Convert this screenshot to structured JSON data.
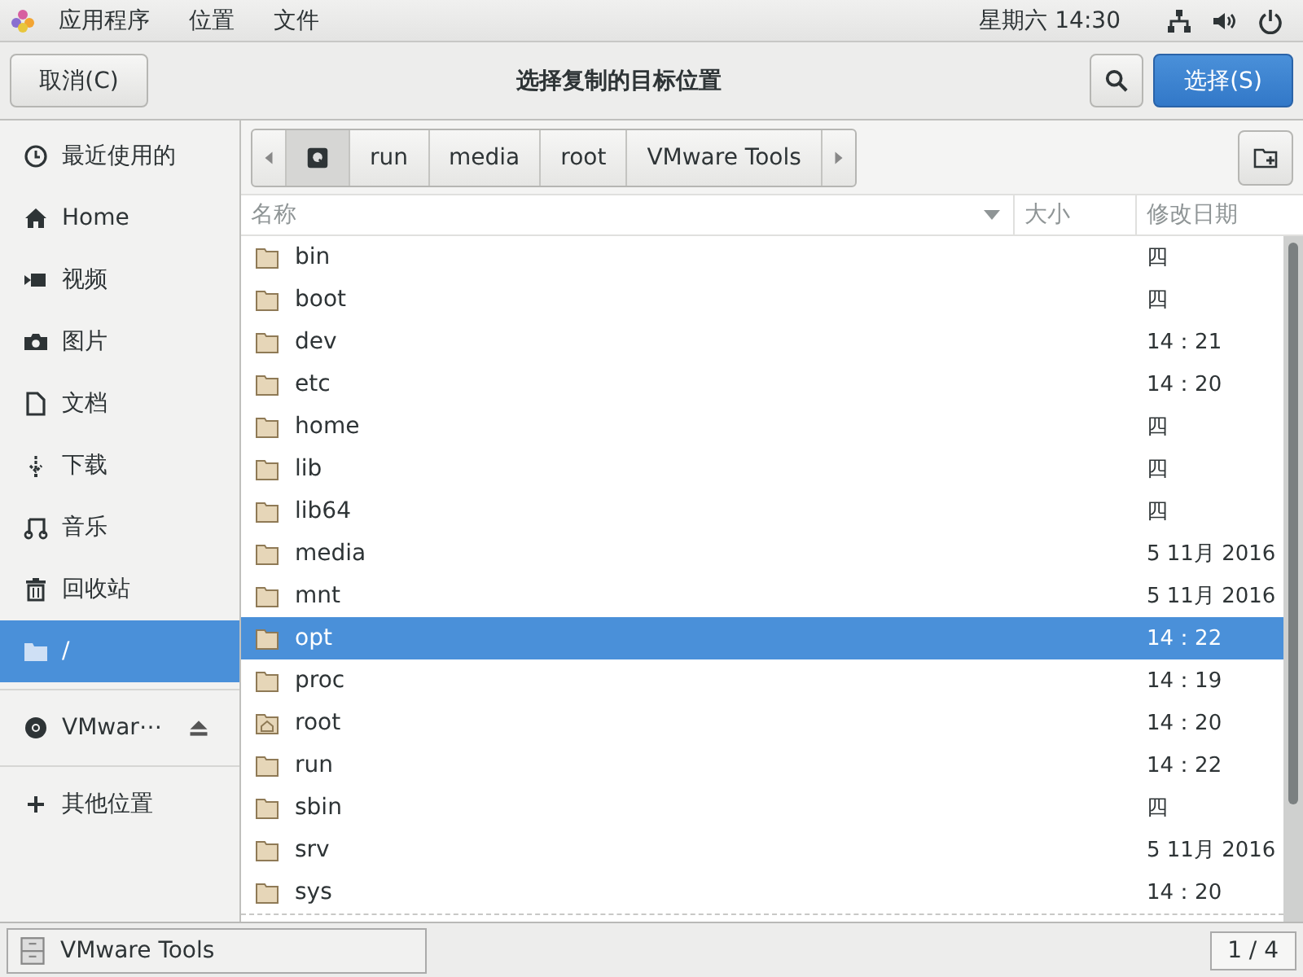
{
  "top_bar": {
    "menus": [
      "应用程序",
      "位置",
      "文件"
    ],
    "clock": "星期六 14:30"
  },
  "header": {
    "cancel": "取消(C)",
    "title": "选择复制的目标位置",
    "select": "选择(S)"
  },
  "sidebar": {
    "items": [
      {
        "kind": "recent",
        "label": "最近使用的",
        "selected": false
      },
      {
        "kind": "home",
        "label": "Home",
        "selected": false
      },
      {
        "kind": "video",
        "label": "视频",
        "selected": false
      },
      {
        "kind": "pictures",
        "label": "图片",
        "selected": false
      },
      {
        "kind": "documents",
        "label": "文档",
        "selected": false
      },
      {
        "kind": "downloads",
        "label": "下载",
        "selected": false
      },
      {
        "kind": "music",
        "label": "音乐",
        "selected": false
      },
      {
        "kind": "trash",
        "label": "回收站",
        "selected": false
      },
      {
        "kind": "root",
        "label": "/",
        "selected": true
      }
    ],
    "devices": [
      {
        "kind": "disc",
        "label": "VMwar⋯"
      }
    ],
    "other": {
      "label": "其他位置"
    }
  },
  "path_bar": {
    "segments": [
      {
        "kind": "drive",
        "selected": true
      },
      {
        "kind": "text",
        "label": "run",
        "selected": false
      },
      {
        "kind": "text",
        "label": "media",
        "selected": false
      },
      {
        "kind": "text",
        "label": "root",
        "selected": false
      },
      {
        "kind": "text",
        "label": "VMware Tools",
        "selected": false
      }
    ]
  },
  "table": {
    "columns": [
      "名称",
      "大小",
      "修改日期"
    ],
    "rows": [
      {
        "kind": "folder",
        "name": "bin",
        "modified": "四",
        "selected": false
      },
      {
        "kind": "folder",
        "name": "boot",
        "modified": "四",
        "selected": false
      },
      {
        "kind": "folder",
        "name": "dev",
        "modified": "14：21",
        "selected": false
      },
      {
        "kind": "folder",
        "name": "etc",
        "modified": "14：20",
        "selected": false
      },
      {
        "kind": "folder",
        "name": "home",
        "modified": "四",
        "selected": false
      },
      {
        "kind": "folder",
        "name": "lib",
        "modified": "四",
        "selected": false
      },
      {
        "kind": "folder",
        "name": "lib64",
        "modified": "四",
        "selected": false
      },
      {
        "kind": "folder",
        "name": "media",
        "modified": "5 11月 2016",
        "selected": false
      },
      {
        "kind": "folder",
        "name": "mnt",
        "modified": "5 11月 2016",
        "selected": false
      },
      {
        "kind": "folder",
        "name": "opt",
        "modified": "14：22",
        "selected": true
      },
      {
        "kind": "folder",
        "name": "proc",
        "modified": "14：19",
        "selected": false
      },
      {
        "kind": "home-folder",
        "name": "root",
        "modified": "14：20",
        "selected": false
      },
      {
        "kind": "folder",
        "name": "run",
        "modified": "14：22",
        "selected": false
      },
      {
        "kind": "folder",
        "name": "sbin",
        "modified": "四",
        "selected": false
      },
      {
        "kind": "folder",
        "name": "srv",
        "modified": "5 11月 2016",
        "selected": false
      },
      {
        "kind": "folder",
        "name": "sys",
        "modified": "14：20",
        "selected": false
      }
    ]
  },
  "taskbar": {
    "window": "VMware Tools",
    "workspace": "1 / 4"
  }
}
